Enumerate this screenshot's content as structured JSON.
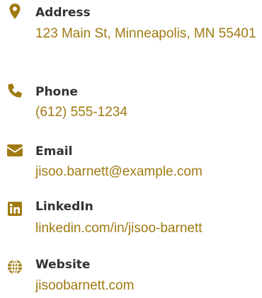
{
  "accent_color": "#a07a12",
  "contacts": [
    {
      "icon": "map-pin-icon",
      "label": "Address",
      "value": "123 Main St, Minneapolis, MN 55401"
    },
    {
      "icon": "phone-icon",
      "label": "Phone",
      "value": "(612) 555-1234"
    },
    {
      "icon": "envelope-icon",
      "label": "Email",
      "value": "jisoo.barnett@example.com"
    },
    {
      "icon": "linkedin-icon",
      "label": "LinkedIn",
      "value": "linkedin.com/in/jisoo-barnett"
    },
    {
      "icon": "globe-icon",
      "label": "Website",
      "value": "jisoobarnett.com"
    }
  ]
}
